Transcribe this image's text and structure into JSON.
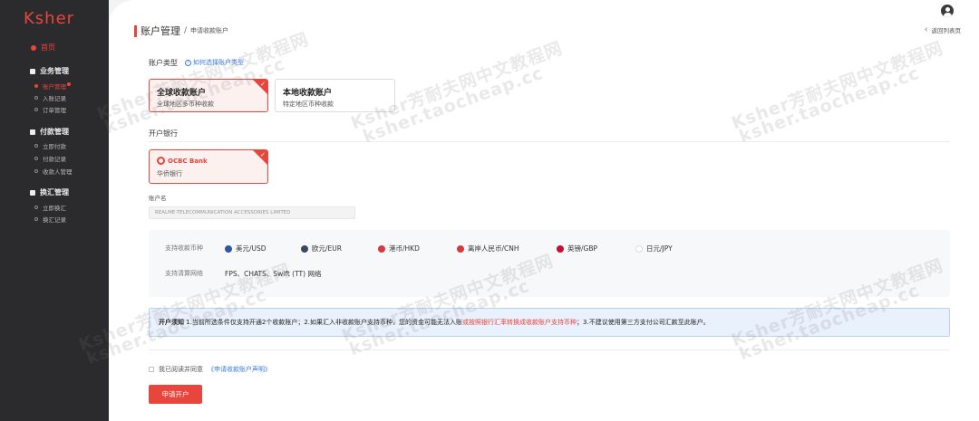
{
  "sidebar": {
    "logo": "Ksher",
    "home": "首页",
    "groups": [
      {
        "label": "业务管理",
        "items": [
          "账户管理",
          "入账记录",
          "订单管理"
        ]
      },
      {
        "label": "付款管理",
        "items": [
          "立即付款",
          "付款记录",
          "收款人管理"
        ]
      },
      {
        "label": "换汇管理",
        "items": [
          "立即换汇",
          "换汇记录"
        ]
      }
    ],
    "active_item": "账户管理"
  },
  "header": {
    "title": "账户管理",
    "separator": "/",
    "subtitle": "申请收款账户",
    "back_label": "返回列表页"
  },
  "account_type": {
    "label": "账户类型",
    "help_link": "如何选择账户类型",
    "options": [
      {
        "title": "全球收款账户",
        "desc": "全球地区多币种收款",
        "selected": true
      },
      {
        "title": "本地收款账户",
        "desc": "特定地区币种收款",
        "selected": false
      }
    ]
  },
  "bank": {
    "label": "开户银行",
    "logo_text": "OCBC Bank",
    "name": "华侨银行"
  },
  "account_name": {
    "label": "账户名",
    "value": "REALME-TELECOMMUNICATION ACCESSORIES LIMITED"
  },
  "currencies": {
    "label": "支持收款币种",
    "items": [
      {
        "name": "美元/USD",
        "color": "#2f55a4"
      },
      {
        "name": "欧元/EUR",
        "color": "#3a4766"
      },
      {
        "name": "港币/HKD",
        "color": "#d9363e"
      },
      {
        "name": "离岸人民币/CNH",
        "color": "#d9363e"
      },
      {
        "name": "英镑/GBP",
        "color": "#c8102e"
      },
      {
        "name": "日元/JPY",
        "color": "#d9363e"
      }
    ]
  },
  "networks": {
    "label": "支持清算网络",
    "value": "FPS、CHATS、Swift (TT) 网络"
  },
  "notice": {
    "head": "开户须知",
    "part1": " 1.当前所选条件仅支持开通2个收款账户；2.如果汇入非收款账户支持币种，您的资金可能无法入账",
    "part_red": "或按照银行汇率转换成收款账户支持币种",
    "part2": "；3.不建议使用第三方支付公司汇款至此账户。"
  },
  "agreement": {
    "text": "我已阅读并同意",
    "link": "《申请收款账户声明》"
  },
  "submit_label": "申请开户",
  "watermark_texts": [
    "Ksher芳耐夫网中文教程网",
    "ksher.taocheap.cc"
  ],
  "colors": {
    "accent": "#e8453c",
    "link": "#3b7be0",
    "sidebar_bg": "#2b2b2d"
  }
}
